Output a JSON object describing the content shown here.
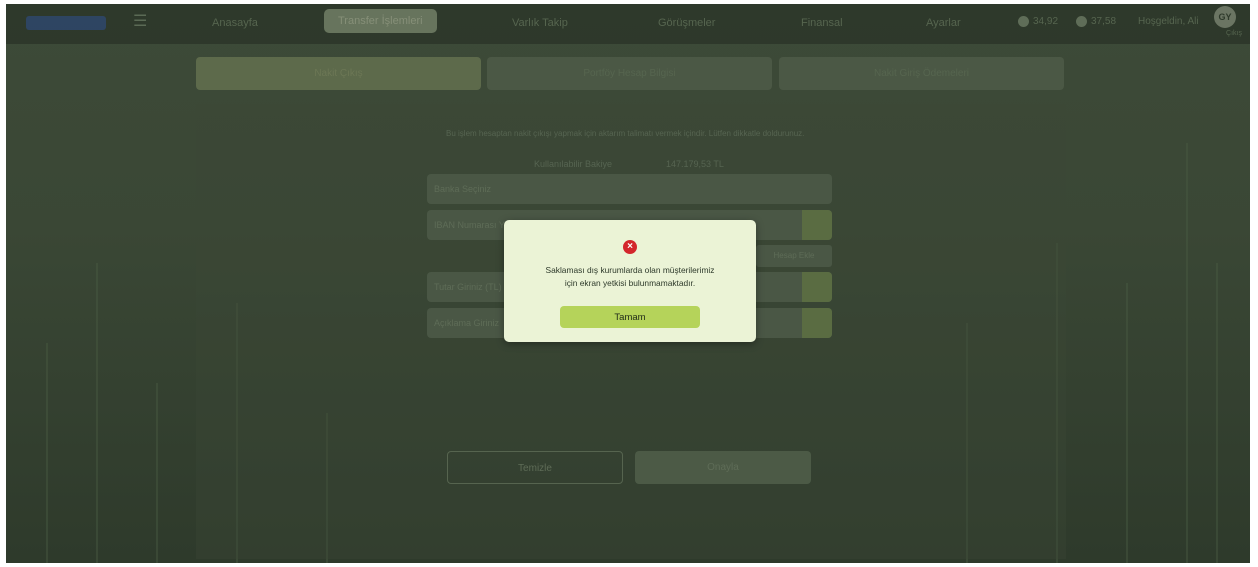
{
  "topbar": {
    "nav": [
      "Anasayfa",
      "Transfer İşlemleri",
      "Varlık Takip",
      "Görüşmeler",
      "Finansal",
      "Ayarlar"
    ],
    "active_nav": "Transfer İşlemleri",
    "tickers": [
      "34,92",
      "37,58"
    ],
    "user_label": "Hoşgeldin, Ali",
    "avatar_initials": "GY",
    "avatar_sub": "Çıkış"
  },
  "subtabs": [
    "Nakit Çıkış",
    "Portföy Hesap Bilgisi",
    "Nakit Giriş Ödemeleri"
  ],
  "form": {
    "info_line": "Bu işlem hesaptan nakit çıkışı yapmak için aktarım talimatı vermek içindir. Lütfen dikkatle doldurunuz.",
    "balance_key": "Kullanılabilir Bakiye",
    "balance_value": "147.179,53 TL",
    "field1_placeholder": "Banka Seçiniz",
    "field2_placeholder": "IBAN Numarası Yazınız",
    "small_btn": "Hesap Ekle",
    "field3_placeholder": "Tutar Giriniz (TL)",
    "field4_placeholder": "Açıklama Giriniz",
    "back_label": "Temizle",
    "next_label": "Onayla"
  },
  "modal": {
    "message_line1": "Saklaması dış kurumlarda olan müşterilerimiz",
    "message_line2": "için ekran yetkisi bulunmamaktadır.",
    "ok_label": "Tamam",
    "error_color": "#d3262c",
    "ok_color": "#b5d35a"
  }
}
